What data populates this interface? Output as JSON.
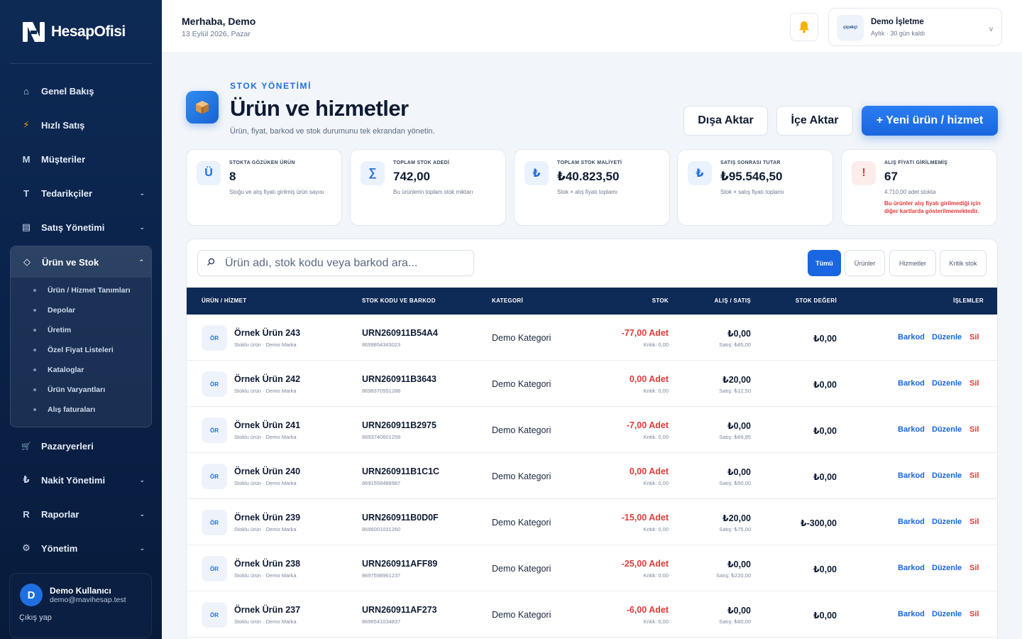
{
  "sidebar": {
    "logo_text": "HesapOfisi",
    "items": [
      {
        "icon": "⌂",
        "label": "Genel Bakış",
        "chevron": ""
      },
      {
        "icon": "⚡",
        "label": "Hızlı Satış",
        "chevron": ""
      },
      {
        "icon": "M",
        "label": "Müşteriler",
        "chevron": ""
      },
      {
        "icon": "T",
        "label": "Tedarikçiler",
        "chevron": "⌄"
      },
      {
        "icon": "▤",
        "label": "Satış Yönetimi",
        "chevron": "⌄"
      }
    ],
    "active_group": {
      "icon": "◇",
      "label": "Ürün ve Stok",
      "chevron": "⌃",
      "sub_items": [
        "Ürün / Hizmet Tanımları",
        "Depolar",
        "Üretim",
        "Özel Fiyat Listeleri",
        "Kataloglar",
        "Ürün Varyantları",
        "Alış faturaları"
      ]
    },
    "items_after": [
      {
        "icon": "🛒",
        "label": "Pazaryerleri",
        "chevron": ""
      },
      {
        "icon": "₺",
        "label": "Nakit Yönetimi",
        "chevron": "⌄"
      },
      {
        "icon": "R",
        "label": "Raporlar",
        "chevron": "⌄"
      },
      {
        "icon": "⚙",
        "label": "Yönetim",
        "chevron": "⌄"
      }
    ],
    "user": {
      "initial": "D",
      "name": "Demo Kullanıcı",
      "email": "demo@mavihesap.test",
      "logout": "Çıkış yap"
    }
  },
  "header": {
    "greeting": "Merhaba, Demo",
    "date": "13 Eylül 2026, Pazar",
    "business": {
      "logo_text": "çiçekçi",
      "name": "Demo İşletme",
      "plan": "Aylık · 30 gün kaldı",
      "chevron": "v"
    }
  },
  "page": {
    "eyebrow": "STOK YÖNETİMİ",
    "title": "Ürün ve hizmetler",
    "description": "Ürün, fiyat, barkod ve stok durumunu tek ekrandan yönetin.",
    "buttons": {
      "export": "Dışa Aktar",
      "import": "İçe Aktar",
      "new": "+ Yeni ürün / hizmet"
    }
  },
  "stats": [
    {
      "icon": "Ü",
      "label": "STOKTA GÖZÜKEN ÜRÜN",
      "value": "8",
      "sub": "Stoğu ve alış fiyatı girilmiş ürün sayısı",
      "warn": ""
    },
    {
      "icon": "∑",
      "label": "TOPLAM STOK ADEDİ",
      "value": "742,00",
      "sub": "Bu ürünlerin toplam stok miktarı",
      "warn": ""
    },
    {
      "icon": "₺",
      "label": "TOPLAM STOK MALİYETİ",
      "value": "₺40.823,50",
      "sub": "Stok × alış fiyatı toplamı",
      "warn": ""
    },
    {
      "icon": "₺",
      "label": "SATIŞ SONRASI TUTAR",
      "value": "₺95.546,50",
      "sub": "Stok × satış fiyatı toplamı",
      "warn": ""
    },
    {
      "icon": "!",
      "label": "ALIŞ FİYATI GİRİLMEMİŞ",
      "value": "67",
      "sub": "4.710,00 adet stokta",
      "warn": "Bu ürünler alış fiyatı girilmediği için diğer kartlarda gösterilmemektedir."
    }
  ],
  "table": {
    "search_placeholder": "Ürün adı, stok kodu veya barkod ara...",
    "filters": [
      "Tümü",
      "Ürünler",
      "Hizmetler",
      "Kritik stok"
    ],
    "headers": {
      "product": "ÜRÜN / HİZMET",
      "code": "STOK KODU VE BARKOD",
      "category": "KATEGORİ",
      "stock": "STOK",
      "price": "ALIŞ / SATIŞ",
      "value": "STOK DEĞERİ",
      "actions": "İŞLEMLER"
    },
    "actions": {
      "barcode": "Barkod",
      "edit": "Düzenle",
      "delete": "Sil"
    },
    "rows": [
      {
        "badge": "ÖR",
        "name": "Örnek Ürün 243",
        "meta": "Stoklu ürün · Demo Marka",
        "code": "URN260911B54A4",
        "barcode": "8699854343023",
        "category": "Demo Kategori",
        "stock": "-77,00 Adet",
        "critical": "Kritik: 0,00",
        "buy": "₺0,00",
        "sell": "Satış: ₺85,00",
        "value": "₺0,00"
      },
      {
        "badge": "ÖR",
        "name": "Örnek Ürün 242",
        "meta": "Stoklu ürün · Demo Marka",
        "code": "URN260911B3643",
        "barcode": "8698370551288",
        "category": "Demo Kategori",
        "stock": "0,00 Adet",
        "critical": "Kritik: 0,00",
        "buy": "₺20,00",
        "sell": "Satış: ₺12,50",
        "value": "₺0,00"
      },
      {
        "badge": "ÖR",
        "name": "Örnek Ürün 241",
        "meta": "Stoklu ürün · Demo Marka",
        "code": "URN260911B2975",
        "barcode": "8693740601259",
        "category": "Demo Kategori",
        "stock": "-7,00 Adet",
        "critical": "Kritik: 0,00",
        "buy": "₺0,00",
        "sell": "Satış: ₺69,95",
        "value": "₺0,00"
      },
      {
        "badge": "ÖR",
        "name": "Örnek Ürün 240",
        "meta": "Stoklu ürün · Demo Marka",
        "code": "URN260911B1C1C",
        "barcode": "8691558488987",
        "category": "Demo Kategori",
        "stock": "0,00 Adet",
        "critical": "Kritik: 0,00",
        "buy": "₺0,00",
        "sell": "Satış: ₺50,00",
        "value": "₺0,00"
      },
      {
        "badge": "ÖR",
        "name": "Örnek Ürün 239",
        "meta": "Stoklu ürün · Demo Marka",
        "code": "URN260911B0D0F",
        "barcode": "8696001031260",
        "category": "Demo Kategori",
        "stock": "-15,00 Adet",
        "critical": "Kritik: 0,00",
        "buy": "₺20,00",
        "sell": "Satış: ₺75,00",
        "value": "₺-300,00"
      },
      {
        "badge": "ÖR",
        "name": "Örnek Ürün 238",
        "meta": "Stoklu ürün · Demo Marka",
        "code": "URN260911AFF89",
        "barcode": "8697598961237",
        "category": "Demo Kategori",
        "stock": "-25,00 Adet",
        "critical": "Kritik: 0,00",
        "buy": "₺0,00",
        "sell": "Satış: ₺220,00",
        "value": "₺0,00"
      },
      {
        "badge": "ÖR",
        "name": "Örnek Ürün 237",
        "meta": "Stoklu ürün · Demo Marka",
        "code": "URN260911AF273",
        "barcode": "8696541034837",
        "category": "Demo Kategori",
        "stock": "-6,00 Adet",
        "critical": "Kritik: 0,00",
        "buy": "₺0,00",
        "sell": "Satış: ₺60,00",
        "value": "₺0,00"
      }
    ]
  }
}
